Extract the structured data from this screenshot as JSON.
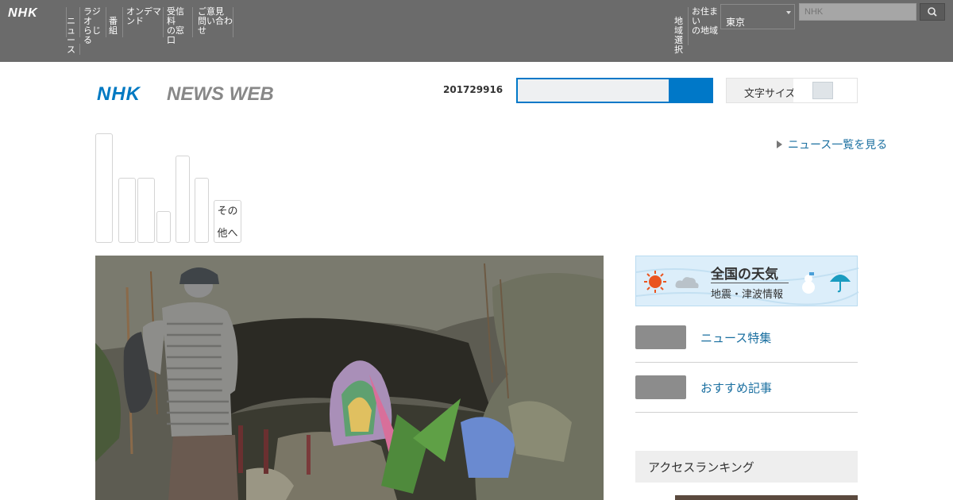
{
  "global_nav": {
    "logo": "NHK",
    "items": [
      {
        "line1": "",
        "line2": "ニュ",
        "line3": "ース"
      },
      {
        "line1": "ラジオ",
        "line2": "らじる",
        "line3": ""
      },
      {
        "line1": "",
        "line2": "番組",
        "line3": ""
      },
      {
        "line1": "オンデマ",
        "line2": "ンド",
        "line3": ""
      },
      {
        "line1": "受信料",
        "line2": "の窓口",
        "line3": ""
      },
      {
        "line1": "ご意見",
        "line2": "問い合わ",
        "line3": "せ"
      }
    ],
    "right_items": [
      {
        "line1": "",
        "line2": "地域",
        "line3": "選択"
      },
      {
        "line1": "お住まい",
        "line2": "の地域",
        "line3": ""
      }
    ],
    "region_select_value": "東京",
    "search_placeholder": "NHK",
    "search_icon": "search-icon"
  },
  "header": {
    "logo_text": "NHK NEWS WEB",
    "date": "201729916",
    "search_placeholder": "",
    "text_size_label": "文字サイズ"
  },
  "category_tabs": [
    {
      "label": ""
    },
    {
      "label": ""
    },
    {
      "label": ""
    },
    {
      "label": ""
    },
    {
      "label": ""
    },
    {
      "label": ""
    }
  ],
  "more_tab": {
    "line1": "その",
    "line2": "他へ"
  },
  "top_link": "ニュース一覧を見る",
  "weather": {
    "title": "全国の天気",
    "subtitle": "地震・津波情報"
  },
  "side_links": [
    {
      "label": "ニュース特集"
    },
    {
      "label": "おすすめ記事"
    }
  ],
  "side_heading": "アクセスランキング"
}
